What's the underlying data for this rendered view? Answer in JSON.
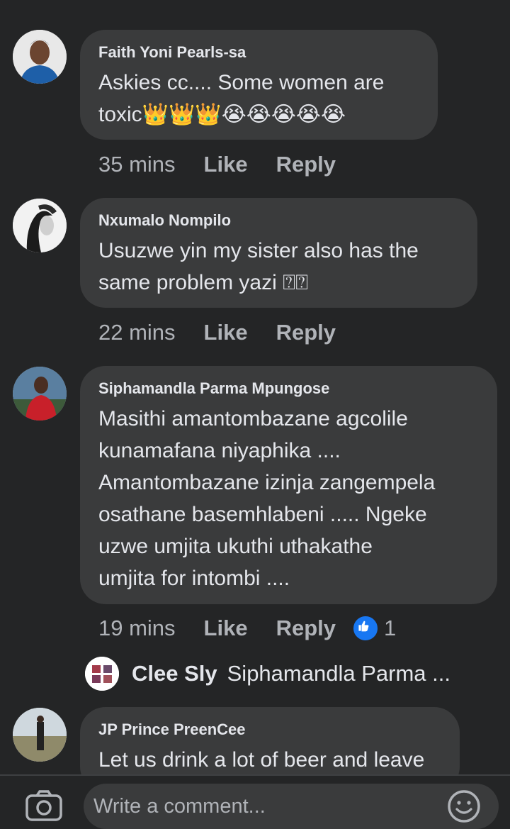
{
  "comments": [
    {
      "author": "Faith Yoni Pearls-sa",
      "text": "Askies cc.... Some women are\ntoxic👑👑👑😭😭😭😭😭",
      "time": "35 mins",
      "like": "Like",
      "reply": "Reply"
    },
    {
      "author": "Nxumalo Nompilo",
      "text": "Usuzwe yin my sister also has the\nsame problem yazi ⍰⍰",
      "time": "22 mins",
      "like": "Like",
      "reply": "Reply"
    },
    {
      "author": "Siphamandla Parma Mpungose",
      "text": " Masithi amantombazane agcolile\nkunamafana niyaphika ....\nAmantombazane izinja zangempela\nosathane basemhlabeni ..... Ngeke\nuzwe umjita ukuthi uthakathe\numjita for intombi ....",
      "time": "19 mins",
      "like": "Like",
      "reply": "Reply",
      "reaction_count": "1",
      "reaction_icon": "like-thumb-icon"
    },
    {
      "author": "JP Prince PreenCee",
      "text": "Let us drink a lot of beer and leave",
      "time": "",
      "like": "",
      "reply": ""
    }
  ],
  "reply_preview": {
    "author": "Clee Sly",
    "text": "Siphamandla Parma ..."
  },
  "composer": {
    "placeholder": "Write a comment...",
    "camera_icon": "camera-icon",
    "emoji_icon": "smiley-icon"
  },
  "colors": {
    "background": "#242526",
    "bubble": "#3a3b3c",
    "text": "#e4e6eb",
    "meta": "#b0b3b8",
    "accent": "#1877f2"
  }
}
